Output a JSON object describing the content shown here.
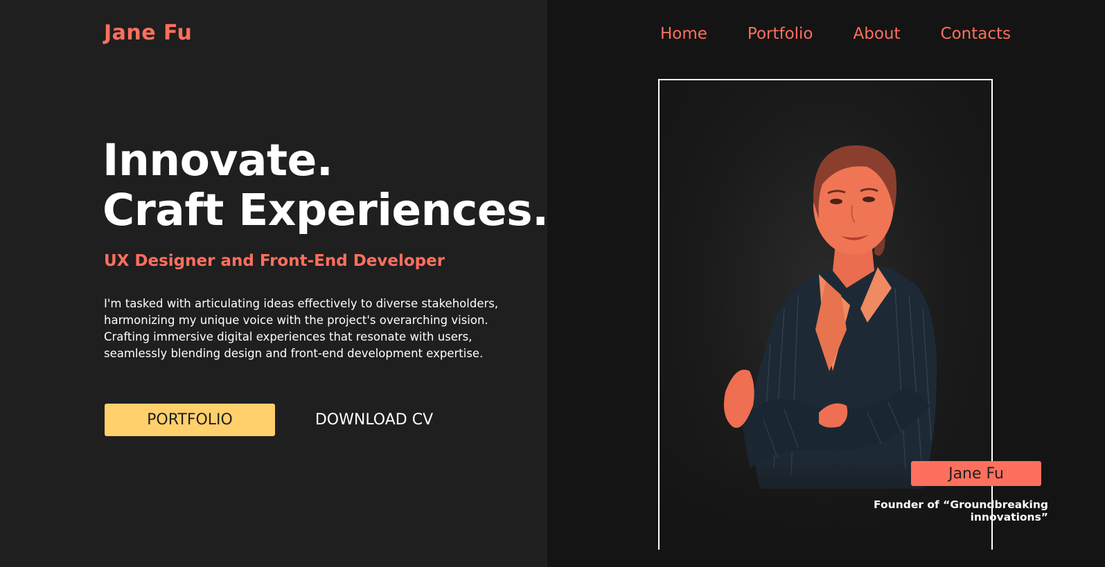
{
  "header": {
    "logo": "Jane Fu",
    "nav": [
      "Home",
      "Portfolio",
      "About",
      "Contacts"
    ]
  },
  "hero": {
    "headline_line1": "Innovate.",
    "headline_line2": "Craft Experiences.",
    "subtitle": "UX Designer and Front-End Developer",
    "description": "I'm tasked with articulating ideas effectively to diverse stakeholders, harmonizing my unique voice with the project's overarching vision. Crafting immersive digital experiences that resonate with users, seamlessly blending design and front-end development expertise.",
    "primary_button": "PORTFOLIO",
    "secondary_button": "DOWNLOAD CV"
  },
  "profile": {
    "name_tag": "Jane Fu",
    "caption": "Founder of “Groundbreaking innovations”"
  },
  "colors": {
    "accent": "#ff6f5e",
    "button_yellow": "#ffd06b",
    "bg_left": "#1f1f1f",
    "bg_right": "#141414"
  }
}
